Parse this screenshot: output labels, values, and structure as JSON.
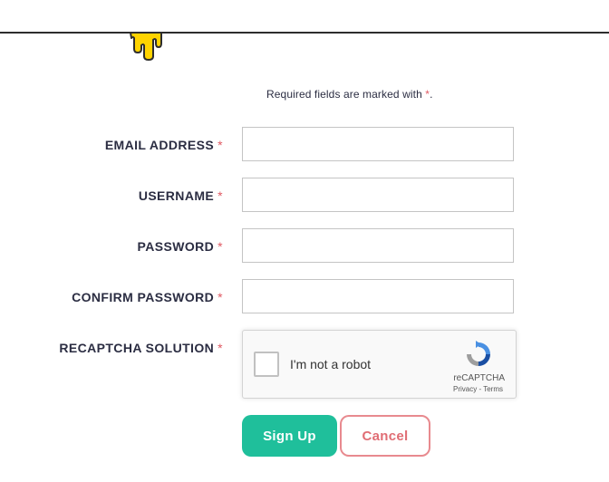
{
  "form": {
    "required_note_prefix": "Required fields are marked with ",
    "required_marker": "*",
    "required_note_suffix": ".",
    "fields": [
      {
        "label": "EMAIL ADDRESS",
        "value": ""
      },
      {
        "label": "USERNAME",
        "value": ""
      },
      {
        "label": "PASSWORD",
        "value": ""
      },
      {
        "label": "CONFIRM PASSWORD",
        "value": ""
      }
    ],
    "captcha_label": "RECAPTCHA SOLUTION"
  },
  "recaptcha": {
    "checkbox_text": "I'm not a robot",
    "brand": "reCAPTCHA",
    "privacy_link": "Privacy",
    "separator": " - ",
    "terms_link": "Terms"
  },
  "actions": {
    "signup_label": "Sign Up",
    "cancel_label": "Cancel"
  },
  "colors": {
    "accent": "#1fbf9b",
    "required_star": "#e05a63",
    "cancel": "#e06d74",
    "logo_yellow": "#ffd400"
  }
}
